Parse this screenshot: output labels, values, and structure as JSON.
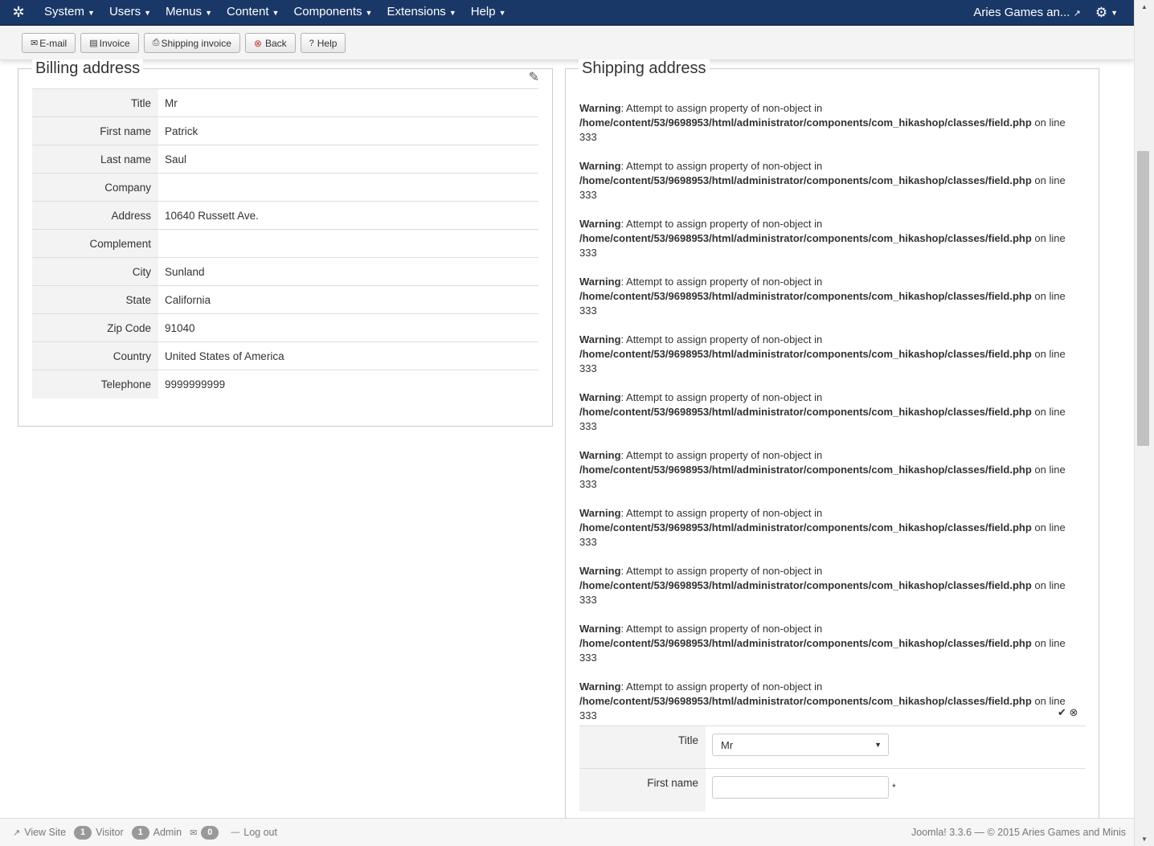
{
  "navbar": {
    "logo_icon": "joomla-logo-icon",
    "menus": [
      "System",
      "Users",
      "Menus",
      "Content",
      "Components",
      "Extensions",
      "Help"
    ],
    "site_name": "Aries Games an...",
    "settings_icon": "gear-icon"
  },
  "toolbar": {
    "buttons": [
      {
        "label": "E-mail",
        "icon": "envelope-icon"
      },
      {
        "label": "Invoice",
        "icon": "document-icon"
      },
      {
        "label": "Shipping invoice",
        "icon": "printer-icon"
      },
      {
        "label": "Back",
        "icon": "cancel-circle-icon"
      },
      {
        "label": "Help",
        "icon": "question-circle-icon"
      }
    ]
  },
  "billing": {
    "legend": "Billing address",
    "rows": [
      {
        "label": "Title",
        "value": "Mr"
      },
      {
        "label": "First name",
        "value": "Patrick"
      },
      {
        "label": "Last name",
        "value": "Saul"
      },
      {
        "label": "Company",
        "value": ""
      },
      {
        "label": "Address",
        "value": "10640 Russett Ave."
      },
      {
        "label": "Complement",
        "value": ""
      },
      {
        "label": "City",
        "value": "Sunland"
      },
      {
        "label": "State",
        "value": "California"
      },
      {
        "label": "Zip Code",
        "value": "91040"
      },
      {
        "label": "Country",
        "value": "United States of America"
      },
      {
        "label": "Telephone",
        "value": "9999999999"
      }
    ]
  },
  "shipping": {
    "legend": "Shipping address",
    "warning": {
      "label": "Warning",
      "message": ": Attempt to assign property of non-object in",
      "path": "/home/content/53/9698953/html/administrator/components/com_hikashop/classes/field.php",
      "suffix": " on line",
      "line": "333",
      "count": 11
    },
    "form": {
      "title_label": "Title",
      "title_value": "Mr",
      "first_name_label": "First name",
      "first_name_value": "",
      "required_mark": "*"
    }
  },
  "statusbar": {
    "view_site": "View Site",
    "visitor_count": "1",
    "visitor_label": "Visitor",
    "admin_count": "1",
    "admin_label": "Admin",
    "messages_count": "0",
    "logout": "Log out",
    "copyright": "Joomla! 3.3.6 — © 2015 Aries Games and Minis"
  }
}
